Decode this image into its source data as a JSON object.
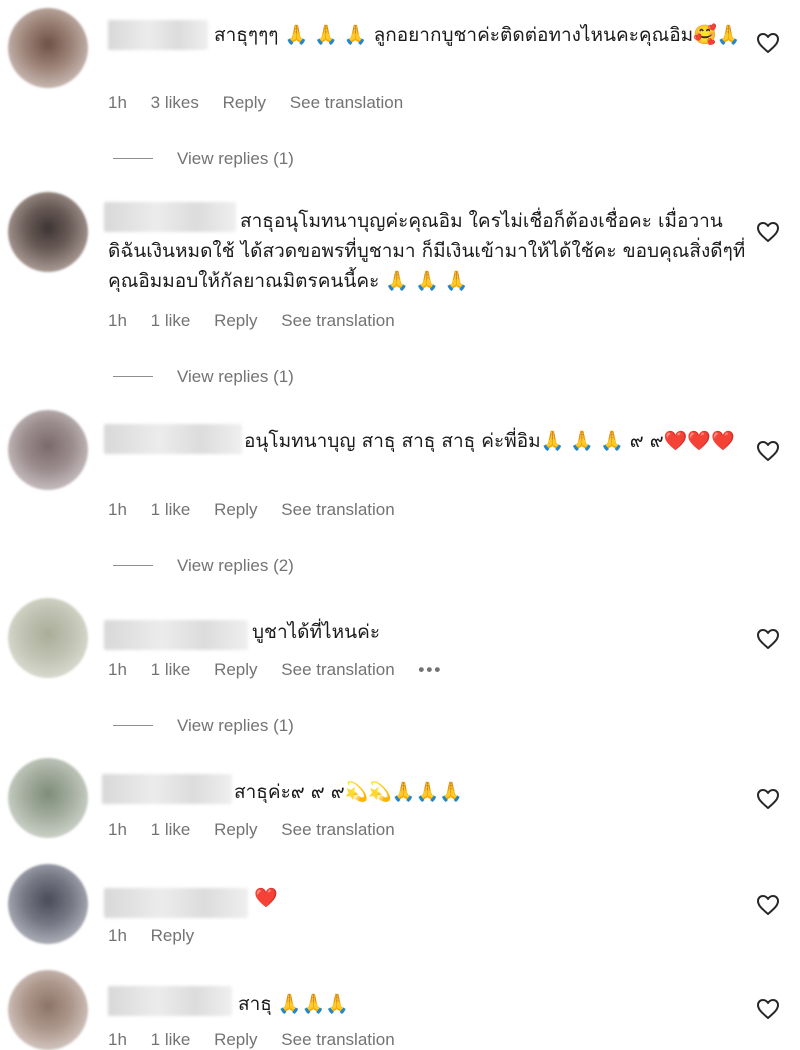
{
  "comments": [
    {
      "text": "สาธุๆๆๆ 🙏 🙏 🙏 ลูกอยากบูชาค่ะติดต่อทางไหนคะคุณอิม🥰🙏",
      "time": "1h",
      "likes": "3 likes",
      "reply": "Reply",
      "translate": "See translation",
      "view_replies": "View replies (1)"
    },
    {
      "text": "สาธุอนุโมทนาบุญค่ะคุณอิม ใครไม่เชื่อก็ต้องเชื่อคะ เมื่อวานดิฉันเงินหมดใช้ ได้สวดขอพรที่บูชามา ก็มีเงินเข้ามาให้ได้ใช้คะ ขอบคุณสิ่งดีๆที่คุณอิมมอบให้กัลยาณมิตรคนนี้คะ 🙏 🙏 🙏",
      "time": "1h",
      "likes": "1 like",
      "reply": "Reply",
      "translate": "See translation",
      "view_replies": "View replies (1)"
    },
    {
      "text": "อนุโมทนาบุญ สาธุ สาธุ สาธุ ค่ะพี่อิม🙏 🙏 🙏 ๙ ๙❤️❤️❤️",
      "time": "1h",
      "likes": "1 like",
      "reply": "Reply",
      "translate": "See translation",
      "view_replies": "View replies (2)"
    },
    {
      "text": "บูชาได้ที่ไหนค่ะ",
      "time": "1h",
      "likes": "1 like",
      "reply": "Reply",
      "translate": "See translation",
      "more": "•••",
      "view_replies": "View replies (1)"
    },
    {
      "text": "สาธุค่ะ๙ ๙ ๙💫💫🙏🙏🙏",
      "time": "1h",
      "likes": "1 like",
      "reply": "Reply",
      "translate": "See translation"
    },
    {
      "text": "❤️",
      "time": "1h",
      "reply": "Reply"
    },
    {
      "text": "สาธุ 🙏🙏🙏",
      "time": "1h",
      "likes": "1 like",
      "reply": "Reply",
      "translate": "See translation"
    }
  ],
  "colors": {
    "text": "#262626",
    "muted": "#737373",
    "heart": "#ed1c24"
  },
  "icons": {
    "like": "heart-outline-icon"
  }
}
